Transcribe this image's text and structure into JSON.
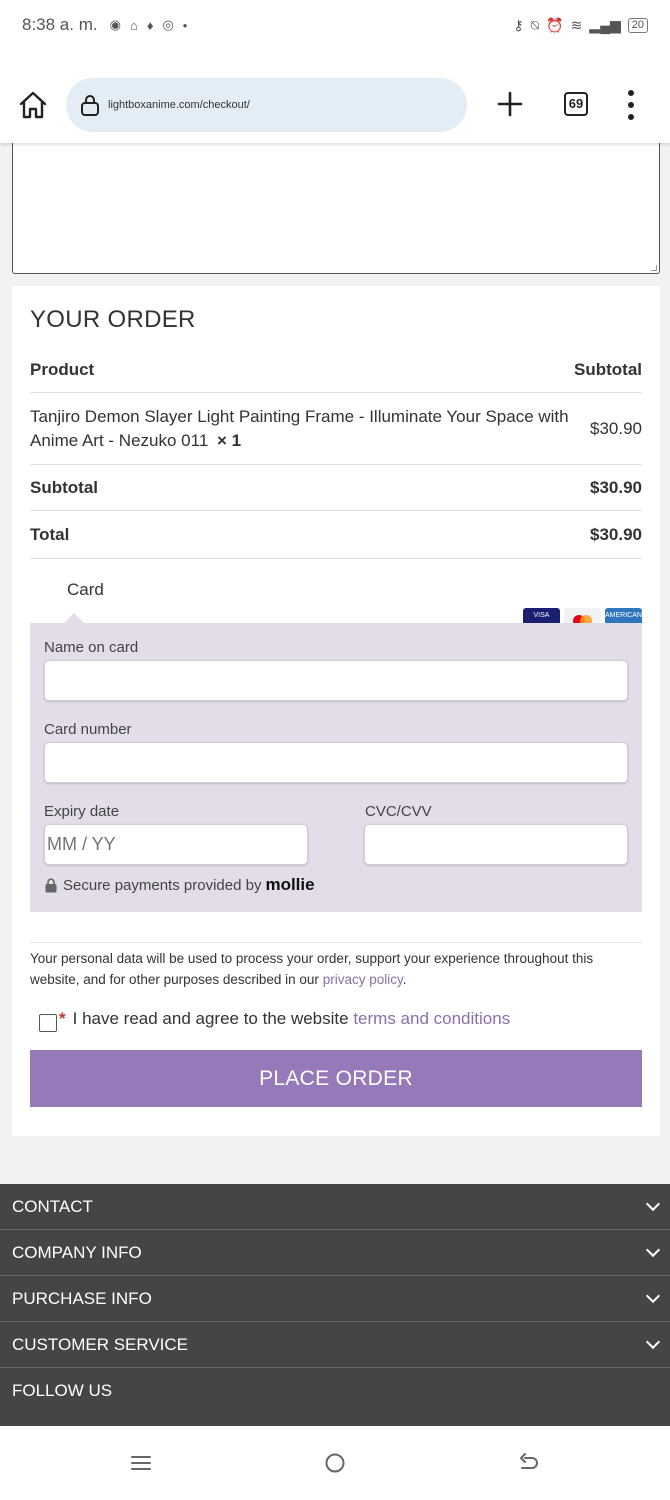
{
  "status_bar": {
    "time": "8:38 a. m.",
    "battery": "20"
  },
  "browser": {
    "url": "lightboxanime.com/checkout/",
    "tab_count": "69"
  },
  "order": {
    "title": "YOUR ORDER",
    "col_product": "Product",
    "col_subtotal": "Subtotal",
    "product_name": "Tanjiro Demon Slayer Light Painting Frame - Illuminate Your Space with Anime Art - Nezuko 011",
    "product_qty": "× 1",
    "product_price": "$30.90",
    "subtotal_label": "Subtotal",
    "subtotal_value": "$30.90",
    "total_label": "Total",
    "total_value": "$30.90"
  },
  "payment": {
    "tab_label": "Card",
    "card_logos": [
      "VISA",
      "MC",
      "AMERICAN"
    ],
    "name_label": "Name on card",
    "number_label": "Card number",
    "expiry_label": "Expiry date",
    "expiry_placeholder": "MM / YY",
    "cvc_label": "CVC/CVV",
    "secure_text": "Secure payments provided by",
    "provider": "mollie"
  },
  "privacy": {
    "text": "Your personal data will be used to process your order, support your experience throughout this website, and for other purposes described in our",
    "link": "privacy policy",
    "end": "."
  },
  "terms": {
    "required_mark": "*",
    "text": "I have read and agree to the website",
    "link": "terms and conditions"
  },
  "place_order_label": "PLACE ORDER",
  "footer": {
    "items": [
      "CONTACT",
      "COMPANY INFO",
      "PURCHASE INFO",
      "CUSTOMER SERVICE",
      "FOLLOW US"
    ]
  },
  "colors": {
    "accent": "#9679b8",
    "panel": "#e3dce9",
    "footer": "#454545"
  }
}
